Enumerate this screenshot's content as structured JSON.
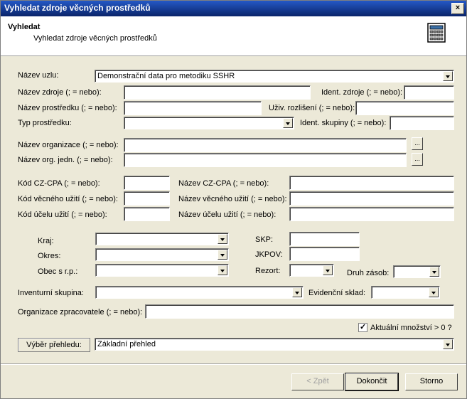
{
  "window": {
    "title": "Vyhledat zdroje věcných prostředků",
    "close_label": "×"
  },
  "header": {
    "title": "Vyhledat",
    "subtitle": "Vyhledat zdroje věcných prostředků",
    "icon": "calculator-icon"
  },
  "form": {
    "nazev_uzlu": {
      "label": "Název uzlu:",
      "value": "Demonstrační data pro metodiku SSHR"
    },
    "nazev_zdroje": {
      "label": "Název zdroje (; = nebo):",
      "value": ""
    },
    "ident_zdroje": {
      "label": "Ident. zdroje (; = nebo):",
      "value": ""
    },
    "nazev_prostredku": {
      "label": "Název prostředku (; = nebo):",
      "value": ""
    },
    "uziv_rozliseni": {
      "label": "Uživ. rozlišení (; = nebo):",
      "value": ""
    },
    "typ_prostredku": {
      "label": "Typ prostředku:",
      "value": ""
    },
    "ident_skupiny": {
      "label": "Ident. skupiny (; = nebo):",
      "value": ""
    },
    "nazev_organizace": {
      "label": "Název organizace (; = nebo):",
      "value": "",
      "button": "..."
    },
    "nazev_org_jedn": {
      "label": "Název org. jedn. (; = nebo):",
      "value": "",
      "button": "..."
    },
    "kod_cz_cpa": {
      "label": "Kód CZ-CPA (; = nebo):",
      "value": ""
    },
    "nazev_cz_cpa": {
      "label": "Název CZ-CPA (; = nebo):",
      "value": ""
    },
    "kod_vecneho_uziti": {
      "label": "Kód věcného užití (; = nebo):",
      "value": ""
    },
    "nazev_vecneho_uziti": {
      "label": "Název věcného užití (; = nebo):",
      "value": ""
    },
    "kod_ucelu_uziti": {
      "label": "Kód účelu užití (; = nebo):",
      "value": ""
    },
    "nazev_ucelu_uziti": {
      "label": "Název účelu užití (; = nebo):",
      "value": ""
    },
    "kraj": {
      "label": "Kraj:",
      "value": ""
    },
    "okres": {
      "label": "Okres:",
      "value": ""
    },
    "obec": {
      "label": "Obec s r.p.:",
      "value": ""
    },
    "skp": {
      "label": "SKP:",
      "value": ""
    },
    "jkpov": {
      "label": "JKPOV:",
      "value": ""
    },
    "rezort": {
      "label": "Rezort:",
      "value": ""
    },
    "druh_zasob": {
      "label": "Druh zásob:",
      "value": ""
    },
    "inventurni_skupina": {
      "label": "Inventurní skupina:",
      "value": ""
    },
    "evidencni_sklad": {
      "label": "Evidenční sklad:",
      "value": ""
    },
    "organizace_zpracovatele": {
      "label": "Organizace zpracovatele (; = nebo):",
      "value": ""
    },
    "aktualni_mnozstvi": {
      "label": "Aktuální množství > 0 ?",
      "checked": true
    },
    "vyber_prehledu": {
      "label": "Výběr přehledu:",
      "value": "Základní přehled"
    }
  },
  "buttons": {
    "back": "< Zpět",
    "finish": "Dokončit",
    "cancel": "Storno"
  }
}
